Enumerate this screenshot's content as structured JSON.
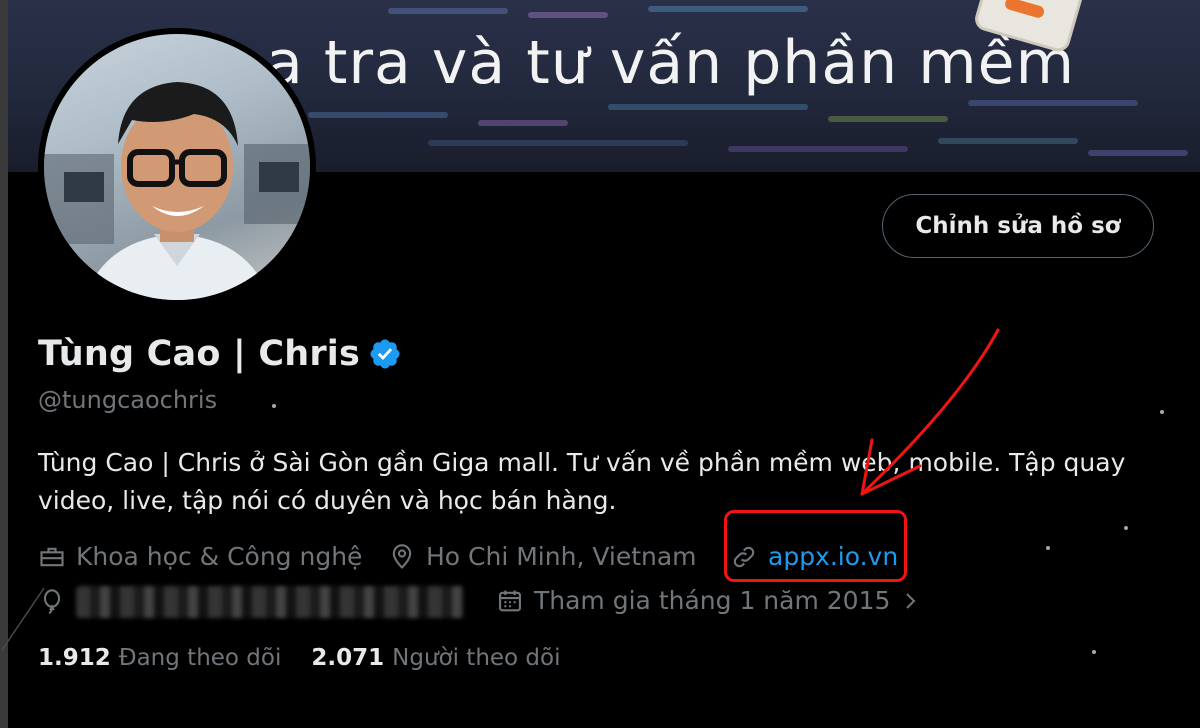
{
  "banner": {
    "text": "a tra và tư vấn phần mềm"
  },
  "profile": {
    "display_name": "Tùng Cao | Chris",
    "handle": "@tungcaochris",
    "edit_button": "Chỉnh sửa hồ sơ",
    "bio": "Tùng Cao | Chris ở Sài Gòn gần Giga mall. Tư vấn về phần mềm web, mobile. Tập quay video, live, tập nói có duyên và học bán hàng."
  },
  "meta": {
    "category": "Khoa học & Công nghệ",
    "location": "Ho Chi Minh, Vietnam",
    "website": "appx.io.vn",
    "joined": "Tham gia tháng 1 năm 2015"
  },
  "stats": {
    "following_count": "1.912",
    "following_label": "Đang theo dõi",
    "followers_count": "2.071",
    "followers_label": "Người theo dõi"
  },
  "icons": [
    "briefcase-icon",
    "location-pin-icon",
    "link-icon",
    "balloon-icon",
    "calendar-icon",
    "chevron-right-icon",
    "verified-badge-icon"
  ],
  "colors": {
    "background": "#000000",
    "text_primary": "#e7e9ea",
    "text_secondary": "#71767b",
    "link": "#1d9bf0",
    "verified": "#1d9bf0",
    "annotation": "#f01414"
  }
}
